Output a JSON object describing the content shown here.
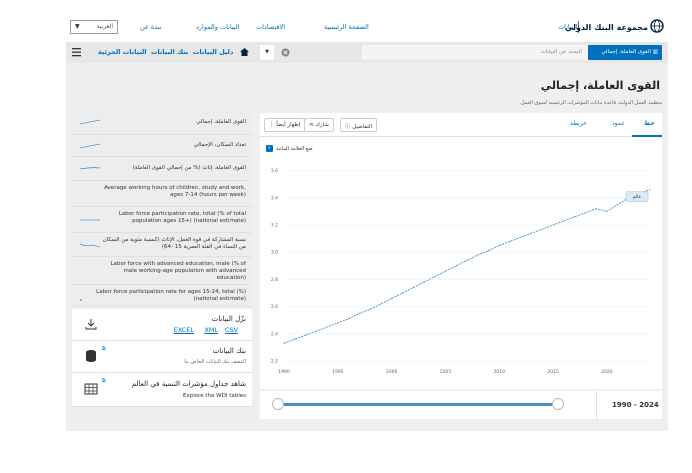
{
  "header": {
    "logo_text": "مجموعة البنك الدولي",
    "data_label": "البيانات",
    "nav": [
      "الصفحة الرئيسية",
      "الاقتصادات",
      "البيانات والموارد",
      "نبذة عن"
    ],
    "language": "العربية"
  },
  "nav_strip": {
    "search_button": "القوى العاملة، إجمالي",
    "search_placeholder": "البحث عن البيانات",
    "links": [
      "دليل البيانات",
      "بنك البيانات",
      "البيانات الجزئية"
    ]
  },
  "page": {
    "title": "القوى العاملة، إجمالي",
    "source": "منظمة العمل الدولية، قاعدة بيانات المؤشرات الرئيسية لسوق العمل."
  },
  "chart_panel": {
    "tabs": [
      "خط",
      "عمود",
      "خريطة"
    ],
    "buttons": {
      "details": "التفاصيل",
      "share": "شارك",
      "show_more": "إظهار أيضاً"
    },
    "checkbox_label": "ضع العلامة المائية",
    "tooltip": "عالم"
  },
  "chart_data": {
    "type": "line",
    "x": [
      1990,
      1991,
      1992,
      1993,
      1994,
      1995,
      1996,
      1997,
      1998,
      1999,
      2000,
      2001,
      2002,
      2003,
      2004,
      2005,
      2006,
      2007,
      2008,
      2009,
      2010,
      2011,
      2012,
      2013,
      2014,
      2015,
      2016,
      2017,
      2018,
      2019,
      2020,
      2021,
      2022,
      2023,
      2024
    ],
    "series": [
      {
        "name": "عالم",
        "values": [
          2.33,
          2.36,
          2.39,
          2.42,
          2.45,
          2.48,
          2.51,
          2.55,
          2.58,
          2.62,
          2.66,
          2.7,
          2.74,
          2.78,
          2.82,
          2.86,
          2.9,
          2.94,
          2.98,
          3.01,
          3.05,
          3.08,
          3.11,
          3.14,
          3.17,
          3.2,
          3.23,
          3.26,
          3.29,
          3.32,
          3.3,
          3.35,
          3.4,
          3.43,
          3.46
        ]
      }
    ],
    "y_ticks": [
      "2.2",
      "2.4",
      "2.6",
      "2.8",
      "3.0",
      "3.2",
      "3.4",
      "3.6"
    ],
    "x_ticks": [
      "1990",
      "1995",
      "2000",
      "2005",
      "2010",
      "2015",
      "2020"
    ],
    "ylim": [
      2.2,
      3.7
    ],
    "xlim": [
      1990,
      2024
    ]
  },
  "range": {
    "label": "1990 - 2024"
  },
  "indicators": [
    "القوى العاملة، إجمالي",
    "تعداد السكان، الإجمالي",
    "القوى العاملة، إناث (% من إجمالي القوى العاملة)",
    "Average working hours of children, study and work, ages 7-14 (hours per week)",
    "Labor force participation rate, total (% of total population ages 15+) (national estimate)",
    "نسبة المشاركة في قوة العمل، الإناث (كنسبة مئوية من السكان من النساء في الفئة العمرية 15 -64)",
    "Labor force with advanced education, male (% of male working-age population with advanced education)",
    "Labor force participation rate for ages 15-24, total (%) (national estimate)"
  ],
  "download": {
    "title": "نزّل البيانات",
    "formats": [
      "CSV",
      "XML",
      "EXCEL"
    ]
  },
  "databank": {
    "title": "بنك البيانات",
    "subtitle": "اكتشف بنك البيانات الخاص بنا"
  },
  "wdi": {
    "title": "شاهد جداول مؤشرات التنمية في العالم",
    "subtitle": "Explore the WDI tables"
  },
  "colors": {
    "accent": "#0071bc",
    "line": "#4a90c8"
  }
}
